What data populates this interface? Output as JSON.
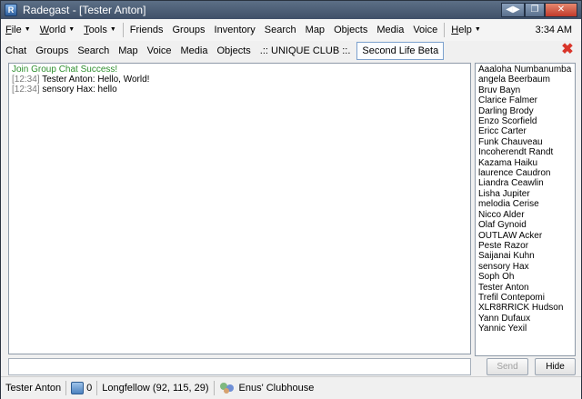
{
  "window": {
    "title": "Radegast - [Tester Anton]",
    "buttons": {
      "back": "◀▶",
      "restore": "❐",
      "close": "✕"
    }
  },
  "menu": {
    "items": [
      {
        "name": "File",
        "key": "F",
        "rest": "ile",
        "dropdown": true
      },
      {
        "name": "World",
        "key": "W",
        "rest": "orld",
        "dropdown": true
      },
      {
        "name": "Tools",
        "key": "T",
        "rest": "ools",
        "dropdown": true
      },
      {
        "name": "Friends"
      },
      {
        "name": "Groups"
      },
      {
        "name": "Inventory"
      },
      {
        "name": "Search"
      },
      {
        "name": "Map"
      },
      {
        "name": "Objects"
      },
      {
        "name": "Media"
      },
      {
        "name": "Voice"
      },
      {
        "name": "Help",
        "key": "H",
        "rest": "elp",
        "dropdown": true
      }
    ],
    "clock": "3:34 AM"
  },
  "tabs": {
    "items": [
      "Chat",
      "Groups",
      "Search",
      "Map",
      "Voice",
      "Media",
      "Objects",
      ".:: UNIQUE CLUB ::."
    ],
    "active": "Second Life Beta"
  },
  "chat": {
    "lines": [
      {
        "kind": "system",
        "text": "Join Group Chat Success!"
      },
      {
        "kind": "msg",
        "time": "[12:34]",
        "text": "Tester Anton: Hello, World!"
      },
      {
        "kind": "msg",
        "time": "[12:34]",
        "text": "sensory Hax: hello"
      }
    ]
  },
  "participants": [
    "Aaaloha Numbanumba",
    "angela Beerbaum",
    "Bruv Bayn",
    "Clarice Falmer",
    "Darling Brody",
    "Enzo Scorfield",
    "Ericc Carter",
    "Funk Chauveau",
    "Incoherendt Randt",
    "Kazama Haiku",
    "laurence Caudron",
    "Liandra Ceawlin",
    "Lisha Jupiter",
    "melodia Cerise",
    "Nicco Alder",
    "Olaf Gynoid",
    "OUTLAW Acker",
    "Peste Razor",
    "Saijanai Kuhn",
    "sensory Hax",
    "Soph Oh",
    "Tester Anton",
    "Trefil Contepomi",
    "XLR8RRICK Hudson",
    "Yann Dufaux",
    "Yannic Yexil"
  ],
  "buttons": {
    "send": "Send",
    "hide": "Hide"
  },
  "status": {
    "name": "Tester Anton",
    "people_count": "0",
    "location": "Longfellow (92, 115, 29)",
    "parcel": "Enus' Clubhouse"
  }
}
